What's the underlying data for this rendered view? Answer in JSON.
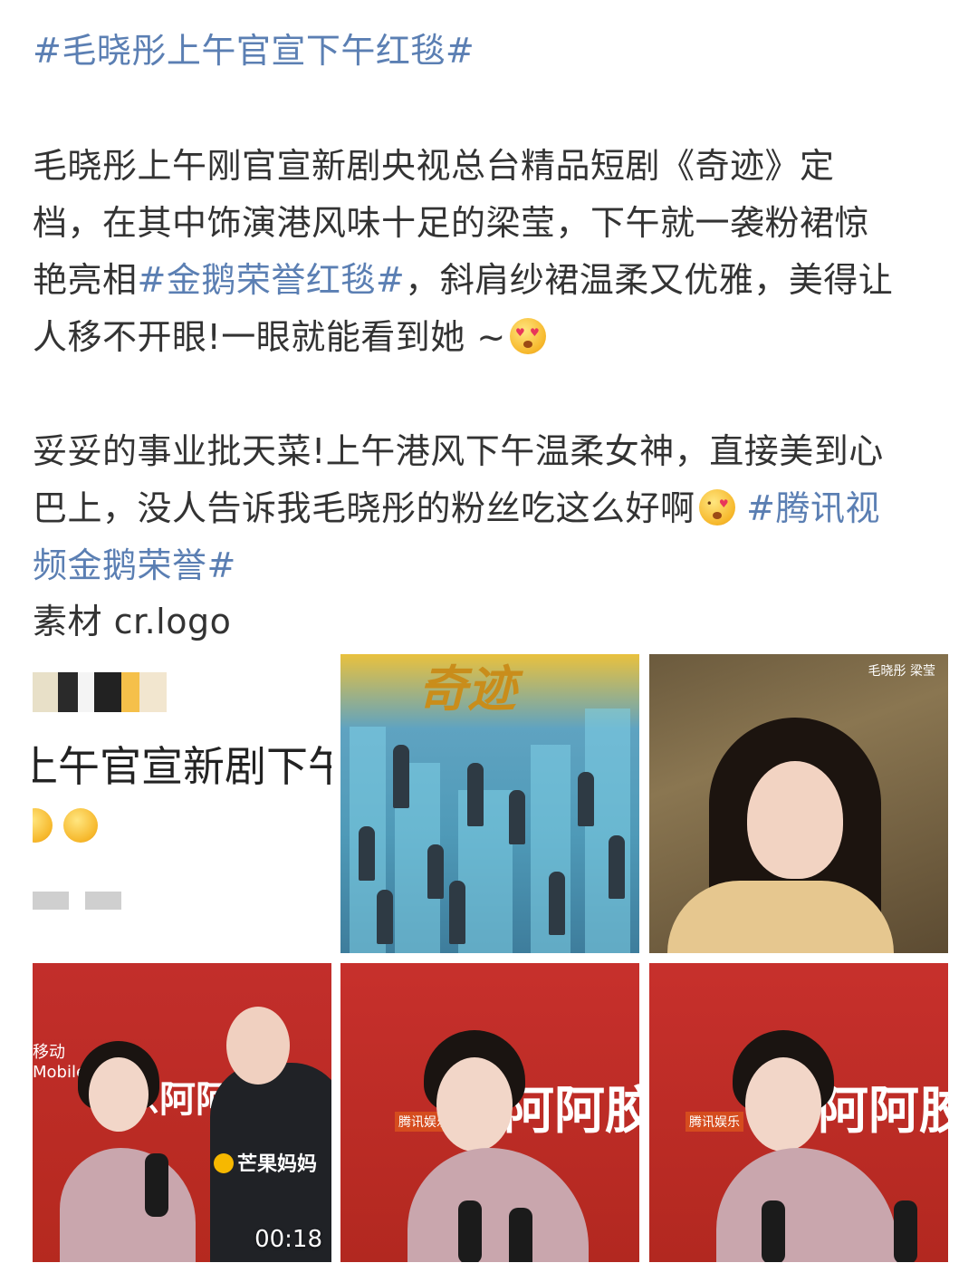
{
  "post": {
    "title_tag": "#毛晓彤上午官宣下午红毯#",
    "p1": {
      "line1": "毛晓彤上午刚官宣新剧央视总台精品短剧《奇迹》定",
      "line2": "档，在其中饰演港风味十足的梁莹，下午就一袭粉裙惊",
      "line3_prefix": "艳亮相",
      "line3_tag": "#金鹅荣誉红毯#",
      "line3_suffix": "，斜肩纱裙温柔又优雅，美得让",
      "line4": "人移不开眼!一眼就能看到她 ~"
    },
    "p2": {
      "line1": "妥妥的事业批天菜!上午港风下午温柔女神，直接美到心",
      "line2_text": "巴上，没人告诉我毛晓彤的粉丝吃这么好啊",
      "line2_tag": "#腾讯视",
      "line3_tag": "频金鹅荣誉#"
    },
    "p3": {
      "source": "素材 cr.logo"
    }
  },
  "images": {
    "img1": {
      "crop_text": "上午官宣新剧下午"
    },
    "img2": {
      "poster_title": "奇迹"
    },
    "img3": {
      "watermark": "毛晓彤 梁莹"
    },
    "img4": {
      "side_text": "移动\nMobile",
      "backdrop": "东阿阿胶",
      "logo": "芒果妈妈",
      "duration": "00:18"
    },
    "img5": {
      "backdrop": "阿阿胶",
      "badge": "腾讯娱乐"
    },
    "img6": {
      "backdrop": "东阿阿胶",
      "badge": "腾讯娱乐"
    }
  },
  "colors": {
    "tag": "#5b7fb3",
    "text": "#333333",
    "carpet": "#c22e2b"
  }
}
